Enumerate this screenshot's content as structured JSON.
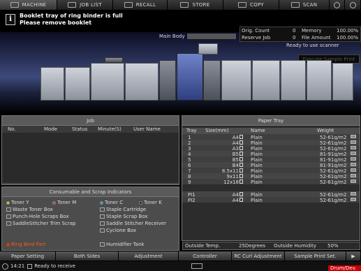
{
  "tabs": [
    {
      "label": "MACHINE",
      "icon": "machine-icon"
    },
    {
      "label": "JOB LIST",
      "icon": "job-list-icon"
    },
    {
      "label": "RECALL",
      "icon": "recall-icon"
    },
    {
      "label": "STORE",
      "icon": "store-icon"
    },
    {
      "label": "COPY",
      "icon": "copy-icon"
    },
    {
      "label": "SCAN",
      "icon": "scan-icon"
    }
  ],
  "message": {
    "line1": "Booklet tray of ring binder is full",
    "line2": "Please remove booklet"
  },
  "counters": {
    "orig_count_label": "Orig. Count",
    "orig_count": "0",
    "memory_label": "Memory",
    "memory": "100.00%",
    "reserve_job_label": "Reserve Job",
    "reserve_job": "0",
    "file_amount_label": "File Amount",
    "file_amount": "100.00%"
  },
  "machine": {
    "main_body_label": "Main Body",
    "status": "Ready to use scanner",
    "sample_print": "Execute Sample Print"
  },
  "job": {
    "title": "Job",
    "columns": [
      "No.",
      "Mode",
      "Status",
      "Minute(S)",
      "User Name"
    ]
  },
  "paper_tray": {
    "title": "Paper Tray",
    "columns": [
      "Tray",
      "Size(mm)",
      "Name",
      "Weight"
    ],
    "rows": [
      {
        "tray": "1",
        "size": "A4",
        "name": "Plain",
        "weight": "52-61g/m2"
      },
      {
        "tray": "2",
        "size": "A4",
        "name": "Plain",
        "weight": "52-61g/m2"
      },
      {
        "tray": "3",
        "size": "A3",
        "name": "Plain",
        "weight": "52-61g/m2"
      },
      {
        "tray": "4",
        "size": "B5",
        "name": "Plain",
        "weight": "81-91g/m2"
      },
      {
        "tray": "5",
        "size": "B5",
        "name": "Plain",
        "weight": "81-91g/m2"
      },
      {
        "tray": "6",
        "size": "B4",
        "name": "Plain",
        "weight": "81-91g/m2"
      },
      {
        "tray": "7",
        "size": "8.5x11",
        "name": "Plain",
        "weight": "52-61g/m2"
      },
      {
        "tray": "8",
        "size": "9x11",
        "name": "Plain",
        "weight": "52-61g/m2"
      },
      {
        "tray": "9",
        "size": "12x18",
        "name": "Plain",
        "weight": "52-61g/m2"
      },
      {
        "tray": "PI1",
        "size": "A4",
        "name": "Plain",
        "weight": "52-61g/m2"
      },
      {
        "tray": "PI2",
        "size": "A4",
        "name": "Plain",
        "weight": "52-61g/m2"
      }
    ],
    "outside_temp_label": "Outside Temp.",
    "outside_temp": "25Degrees",
    "outside_humidity_label": "Outside Humidity",
    "outside_humidity": "50%"
  },
  "consumables": {
    "title": "Consumable and Scrap Indicators",
    "toner_y": "Toner Y",
    "toner_m": "Toner M",
    "toner_c": "Toner C",
    "toner_k": "Toner K",
    "waste_toner": "Waste Toner Box",
    "staple_cartridge": "Staple Cartridge",
    "punch_hole": "Punch-Hole Scraps Box",
    "staple_scrap": "Staple Scrap Box",
    "saddle_trim": "SaddleStitcher Trim Scrap",
    "saddle_receiver": "Saddle Stitcher Receiver",
    "cyclone": "Cyclone Box",
    "ring_bind": "Ring Bind Part",
    "humidifier": "Humidifier Tank"
  },
  "bottom_buttons": [
    "Paper Setting",
    "Both Sides",
    "Adjustment",
    "Controller",
    "RC Curl Adjustment",
    "Sample Print Set."
  ],
  "status": {
    "time": "14:21",
    "text": "Ready to receive",
    "drum": "Drum/Dev."
  },
  "colors": {
    "alert": "#cc0000",
    "toner_y": "#e6c800",
    "toner_m": "#d03080",
    "toner_c": "#1aa0e0",
    "toner_k": "#222222",
    "ring_bind": "#d04000"
  }
}
